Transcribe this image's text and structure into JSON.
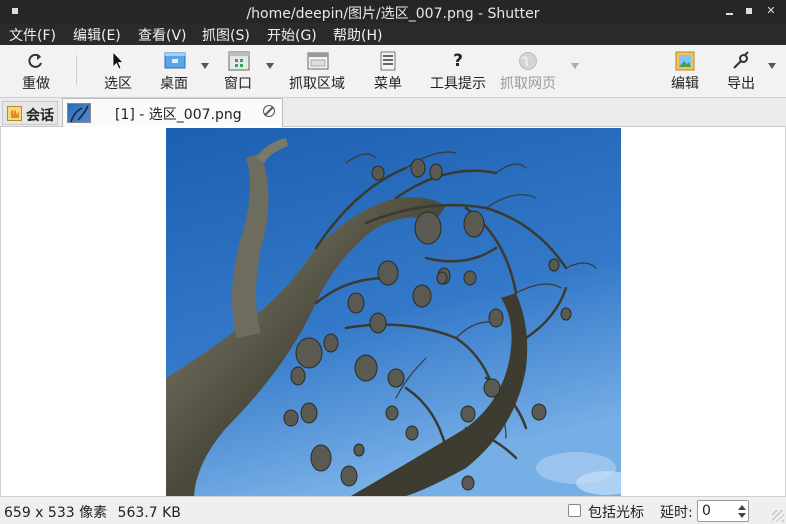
{
  "window": {
    "title": "/home/deepin/图片/选区_007.png - Shutter"
  },
  "menubar": {
    "items": [
      "文件(F)",
      "编辑(E)",
      "查看(V)",
      "抓图(S)",
      "开始(G)",
      "帮助(H)"
    ]
  },
  "toolbar": {
    "redo": "重做",
    "selection": "选区",
    "desktop": "桌面",
    "window": "窗口",
    "capture_area": "抓取区域",
    "menu": "菜单",
    "tooltip": "工具提示",
    "capture_web": "抓取网页",
    "edit": "编辑",
    "export": "导出"
  },
  "tabs": {
    "session": "会话",
    "file": "[1] - 选区_007.png"
  },
  "statusbar": {
    "dimensions": "659 x 533 像素",
    "filesize": "563.7 KB",
    "include_cursor": "包括光标",
    "delay_label": "延时:",
    "delay_value": "0"
  },
  "colors": {
    "titlebar": "#262626",
    "menubar": "#2a2a2a",
    "sky": "#2f6fc0"
  }
}
